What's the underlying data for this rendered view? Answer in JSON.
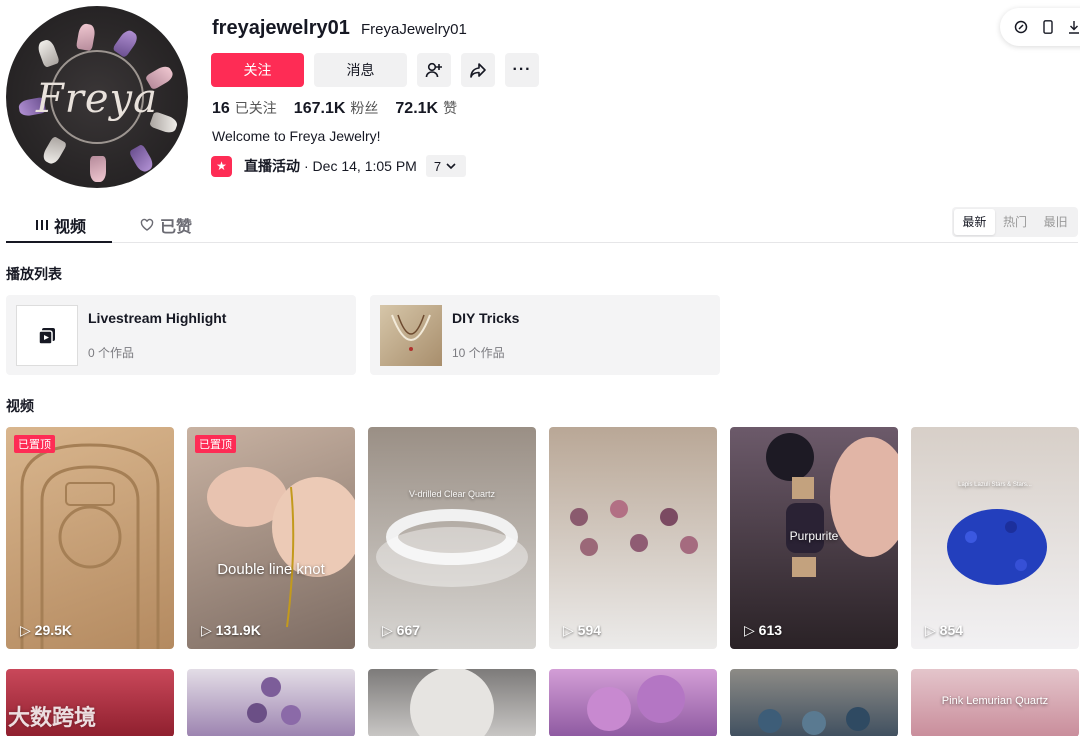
{
  "profile": {
    "username": "freyajewelry01",
    "nickname": "FreyaJewelry01",
    "avatar_text": "Freya",
    "follow_label": "关注",
    "message_label": "消息",
    "bio": "Welcome to Freya Jewelry!",
    "stats": {
      "following_value": "16",
      "following_label": "已关注",
      "followers_value": "167.1K",
      "followers_label": "粉丝",
      "likes_value": "72.1K",
      "likes_label": "赞"
    },
    "live": {
      "label": "直播活动",
      "date": "· Dec 14, 1:05 PM",
      "count": "7"
    }
  },
  "tabs": {
    "videos": "视频",
    "liked": "已赞"
  },
  "sort": {
    "latest": "最新",
    "popular": "热门",
    "oldest": "最旧"
  },
  "playlists_title": "播放列表",
  "playlists": [
    {
      "title": "Livestream Highlight",
      "count": "0 个作品"
    },
    {
      "title": "DIY Tricks",
      "count": "10 个作品"
    }
  ],
  "videos_title": "视频",
  "videos": [
    {
      "views": "29.5K",
      "pinned": "已置顶",
      "caption": "",
      "color": "#c9a27a"
    },
    {
      "views": "131.9K",
      "pinned": "已置顶",
      "caption": "Double line knot",
      "color": "#8a7a70"
    },
    {
      "views": "667",
      "pinned": "",
      "caption": "V-drilled Clear Quartz",
      "color": "#b8b6b3"
    },
    {
      "views": "594",
      "pinned": "",
      "caption": "",
      "color": "#ddd7d4"
    },
    {
      "views": "613",
      "pinned": "",
      "caption": "Purpurite",
      "color": "#5b4a5c"
    },
    {
      "views": "854",
      "pinned": "",
      "caption": "Lapis Lazuli Stars & Stars...",
      "color": "#e9e7ea"
    }
  ],
  "videos_row2": [
    {
      "caption": "",
      "color": "#b33a48"
    },
    {
      "caption": "",
      "color": "#c8bfd3"
    },
    {
      "caption": "",
      "color": "#a9a8a8"
    },
    {
      "caption": "",
      "color": "#b68ac1"
    },
    {
      "caption": "",
      "color": "#6d7a88"
    },
    {
      "caption": "Pink Lemurian Quartz",
      "color": "#d9aab5"
    }
  ],
  "watermark": "大数跨境",
  "colors": {
    "accent": "#fe2c55",
    "text": "#161823",
    "muted": "#f1f1f2"
  }
}
